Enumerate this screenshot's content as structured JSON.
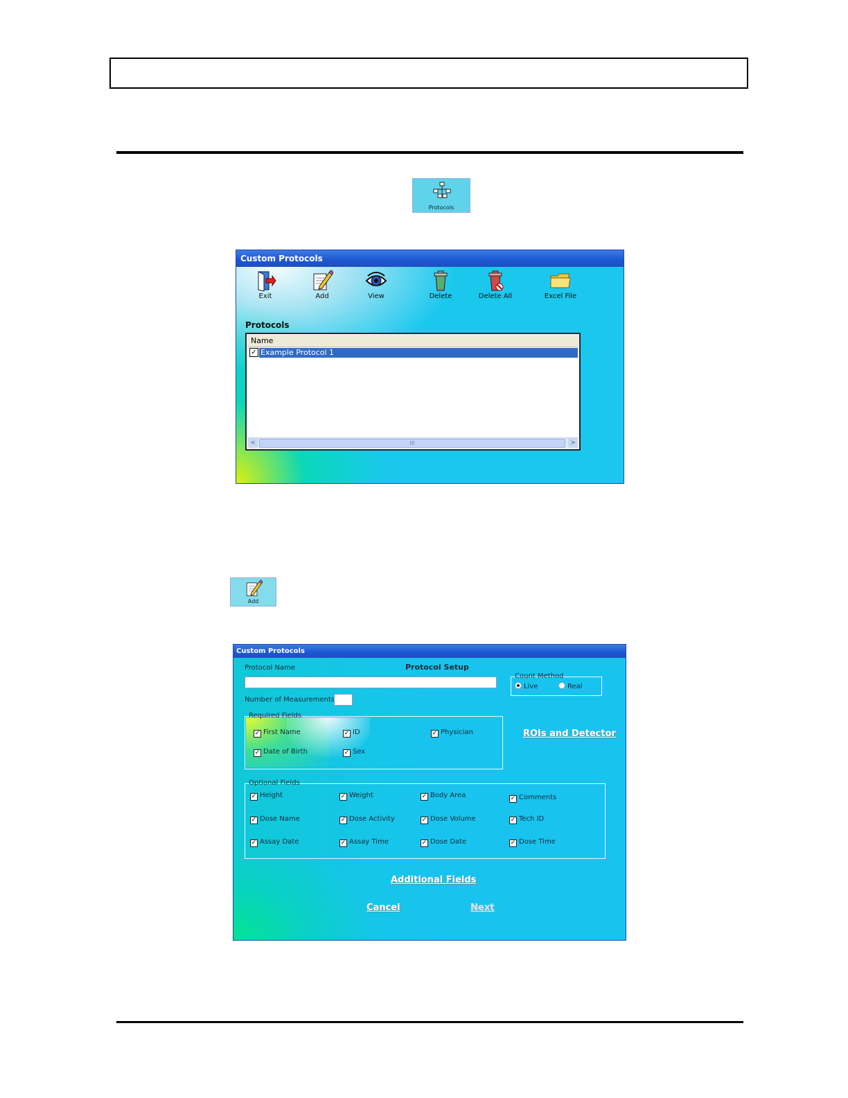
{
  "protocols_button": {
    "label": "Protocols",
    "icon": "protocols-hierarchy-icon"
  },
  "add_button": {
    "label": "Add",
    "icon": "pencil-notepad-icon"
  },
  "window1": {
    "title": "Custom Protocols",
    "toolbar": [
      {
        "label": "Exit",
        "icon": "exit-door-icon"
      },
      {
        "label": "Add",
        "icon": "pencil-notepad-icon"
      },
      {
        "label": "View",
        "icon": "eye-icon"
      },
      {
        "label": "Delete",
        "icon": "trash-can-icon"
      },
      {
        "label": "Delete All",
        "icon": "trash-delete-all-icon"
      },
      {
        "label": "Excel File",
        "icon": "folder-icon"
      }
    ],
    "section_label": "Protocols",
    "list_header": "Name",
    "rows": [
      {
        "name": "Example Protocol 1",
        "checked": true,
        "selected": true
      }
    ],
    "scroll_grip": "III",
    "scroll_left": "<",
    "scroll_right": ">"
  },
  "window2": {
    "title": "Custom Protocols",
    "heading": "Protocol Setup",
    "protocol_name_label": "Protocol Name",
    "protocol_name_value": "",
    "num_measurements_label": "Number of Measurements",
    "num_measurements_value": "",
    "count_method": {
      "title": "Count Method",
      "options": [
        "Live",
        "Real"
      ],
      "selected": "Live"
    },
    "required_fields": {
      "title": "Required Fields",
      "items": [
        "First Name",
        "ID",
        "Physician",
        "Date of Birth",
        "Sex"
      ]
    },
    "optional_fields": {
      "title": "Optional Fields",
      "items": [
        "Height",
        "Weight",
        "Body Area",
        "Comments",
        "Dose Name",
        "Dose Activity",
        "Dose Volume",
        "Tech ID",
        "Assay Date",
        "Assay Time",
        "Dose Date",
        "Dose Time"
      ]
    },
    "rois_button": "ROIs and Detector",
    "additional_fields_button": "Additional Fields",
    "cancel_button": "Cancel",
    "next_button": "Next",
    "check_mark": "✓"
  },
  "colors": {
    "accent": "#1c56d2",
    "selection": "#316ac5",
    "client": "#1ac8ee"
  }
}
